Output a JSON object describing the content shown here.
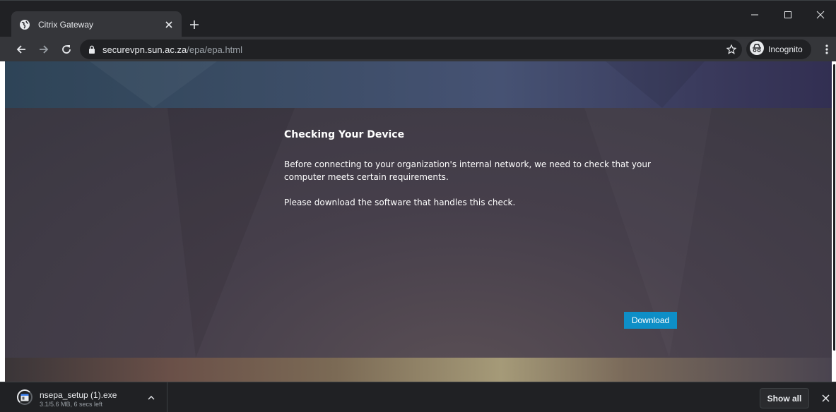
{
  "tab": {
    "title": "Citrix Gateway",
    "favicon": "globe-icon",
    "close_icon": "close-icon"
  },
  "window_controls": [
    "minimize-icon",
    "maximize-icon",
    "close-icon"
  ],
  "toolbar": {
    "back_icon": "back-arrow-icon",
    "forward_icon": "forward-arrow-icon",
    "reload_icon": "reload-icon",
    "url_host": "securevpn.sun.ac.za",
    "url_path": "/epa/epa.html",
    "lock_icon": "lock-icon",
    "bookmark_icon": "star-icon",
    "incognito_label": "Incognito",
    "menu_icon": "kebab-menu-icon"
  },
  "page": {
    "heading": "Checking Your Device",
    "paragraph1": "Before connecting to your organization's internal network, we need to check that your computer meets certain requirements.",
    "paragraph2": "Please download the software that handles this check.",
    "download_button": "Download",
    "button_color": "#0e8fc7"
  },
  "download_shelf": {
    "file_name": "nsepa_setup (1).exe",
    "status": "3.1/5.6 MB, 6 secs left",
    "progress": 0.55,
    "show_all_label": "Show all"
  }
}
